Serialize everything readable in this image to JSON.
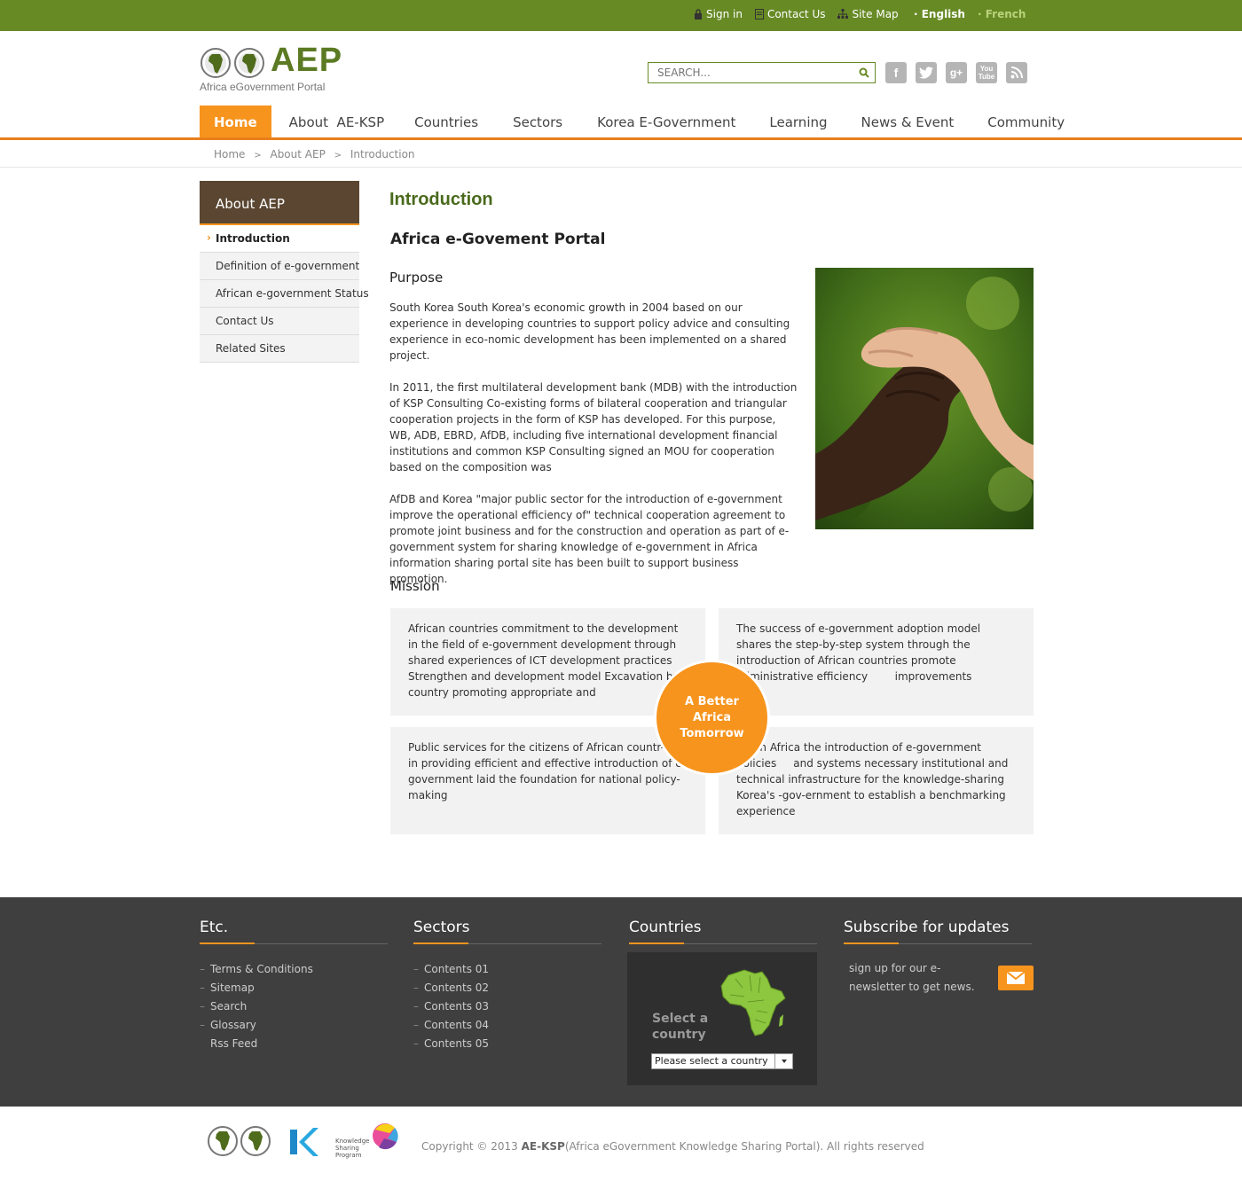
{
  "topbar": {
    "sign_in": "Sign in",
    "contact_us": "Contact Us",
    "site_map": "Site Map",
    "lang_english": "· English",
    "lang_french": "· French",
    "bg_color": "#678a25"
  },
  "brand": {
    "name": "AEP",
    "subtitle": "Africa eGovernment Portal"
  },
  "search": {
    "placeholder": "SEARCH..."
  },
  "social": [
    "facebook-icon",
    "twitter-icon",
    "google-plus-icon",
    "youtube-icon",
    "rss-icon"
  ],
  "nav": [
    "Home",
    "About  AE-KSP",
    "Countries",
    "Sectors",
    "Korea E-Government",
    "Learning",
    "News & Event",
    "Community"
  ],
  "breadcrumb": {
    "home": "Home",
    "sep": ">",
    "about": "About AEP",
    "current": "Introduction"
  },
  "sidebar": {
    "title": "About AEP",
    "items": [
      "Introduction",
      "Definition of e-government",
      "African e-government Status",
      "Contact Us",
      "Related Sites"
    ]
  },
  "main": {
    "title": "Introduction",
    "subtitle": "Africa e-Govement Portal",
    "purpose_heading": "Purpose",
    "paragraphs": [
      "South Korea South Korea's economic growth in 2004 based on our experience in developing countries to support policy advice and consulting experience in eco-nomic development has been implemented on a shared project.",
      "In 2011, the first multilateral development bank (MDB) with the introduction of KSP Consulting Co-existing forms of bilateral cooperation and triangular cooperation projects in the form of KSP has developed. For this purpose, WB, ADB, EBRD, AfDB, including five international development financial institutions and common KSP Consulting signed an MOU for cooperation based on the composition was",
      "AfDB and Korea \"major public sector for the introduction of e-government improve the operational efficiency of\" technical cooperation agreement to promote joint business and for the construction and operation as part of e-government system for sharing knowledge of e-government in Africa information sharing portal site has been built to support business promotion."
    ],
    "mission_heading": "Mission",
    "mission_boxes": [
      "African countries commitment to the development in the field of e-government development through shared experiences of ICT development practices  Strengthen and development model Excavation  by country promoting appropriate and",
      "The success of e-government adoption model shares the step-by-step system through the introduction of African countries promote administrative efficiency        improvements",
      "Public services for the citizens of African countr-ies in providing efficient and effective introduction of e-government laid the foundation for national policy-making",
      "      In Africa the introduction of e-government policies     and systems necessary institutional and technical infrastructure for the knowledge-sharing Korea's -gov-ernment to establish a benchmarking experience"
    ],
    "circle_text": "A Better Africa Tomorrow"
  },
  "footer": {
    "etc_title": "Etc.",
    "etc_items": [
      "Terms & Conditions",
      "Sitemap",
      "Search",
      "Glossary",
      "Rss Feed"
    ],
    "sectors_title": "Sectors",
    "sectors_items": [
      "Contents 01",
      "Contents 02",
      "Contents 03",
      "Contents 04",
      "Contents 05"
    ],
    "countries_title": "Countries",
    "select_label": "Select a country",
    "select_value": "Please select a country",
    "subscribe_title": "Subscribe for updates",
    "subscribe_text": "sign up for our e-newsletter to get news.",
    "copyright_prefix": "Copyright © 2013 ",
    "copyright_brand": "AE-KSP",
    "copyright_suffix": "(Africa eGovernment Knowledge Sharing Portal). All rights reserved",
    "ksp_logo_text": "Knowledge Sharing Program"
  },
  "colors": {
    "green": "#678a25",
    "orange": "#f7941d",
    "brown": "#5a4631",
    "footer_bg": "#3f3f3f"
  }
}
